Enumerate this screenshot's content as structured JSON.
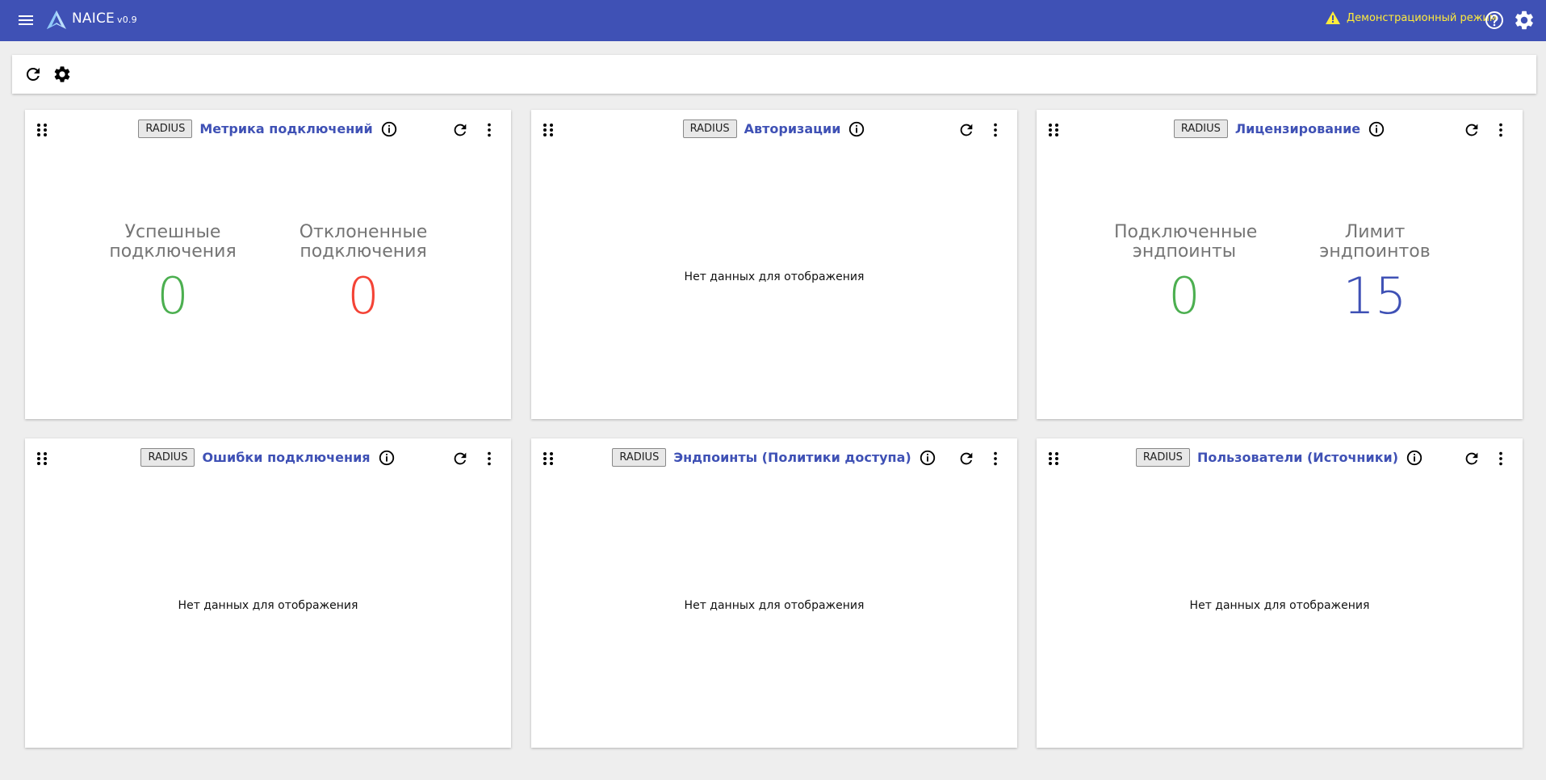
{
  "app": {
    "name": "NAICE",
    "version": "v0.9",
    "demo_mode": "Демонстрационный режим"
  },
  "colors": {
    "primary": "#3f51b5",
    "success": "#4caf50",
    "danger": "#f44336",
    "warning": "#ffeb3b"
  },
  "toolbar": {
    "icons": [
      "refresh-icon",
      "gear-icon"
    ]
  },
  "widgets": [
    {
      "tag": "RADIUS",
      "title": "Метрика подключений",
      "metrics": [
        {
          "label": "Успешные подключения",
          "value": "0",
          "color": "#4caf50"
        },
        {
          "label": "Отклоненные подключения",
          "value": "0",
          "color": "#f44336"
        }
      ]
    },
    {
      "tag": "RADIUS",
      "title": "Авторизации",
      "empty_text": "Нет данных для отображения"
    },
    {
      "tag": "RADIUS",
      "title": "Лицензирование",
      "metrics": [
        {
          "label": "Подключенные эндпоинты",
          "value": "0",
          "color": "#4caf50"
        },
        {
          "label": "Лимит эндпоинтов",
          "value": "15",
          "color": "#3f51b5"
        }
      ]
    },
    {
      "tag": "RADIUS",
      "title": "Ошибки подключения",
      "empty_text": "Нет данных для отображения"
    },
    {
      "tag": "RADIUS",
      "title": "Эндпоинты (Политики доступа)",
      "empty_text": "Нет данных для отображения"
    },
    {
      "tag": "RADIUS",
      "title": "Пользователи (Источники)",
      "empty_text": "Нет данных для отображения"
    }
  ]
}
